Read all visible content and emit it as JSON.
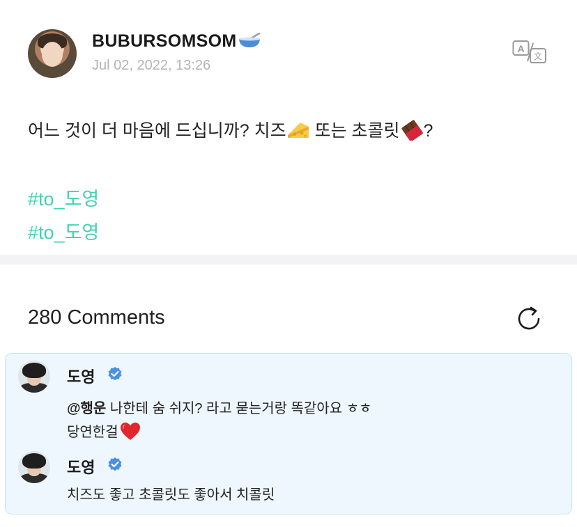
{
  "post": {
    "author": "BUBURSOMSOM",
    "author_emoji": "bowl-spoon-icon",
    "date": "Jul 02, 2022, 13:26",
    "text_part1": "어느 것이 더 마음에 드십니까? 치즈",
    "text_part2": " 또는 초콜릿",
    "text_part3": "?",
    "hashtags": [
      "#to_도영",
      "#to_도영"
    ]
  },
  "comments_section": {
    "count_label": "280 Comments"
  },
  "thread": {
    "comments": [
      {
        "author": "도영",
        "mention": "@행운",
        "line1": " 나한테 숨 쉬지? 라고 묻는거랑 똑같아요 ㅎㅎ",
        "line2": "당연한걸"
      },
      {
        "author": "도영",
        "line1": "치즈도 좋고 초콜릿도 좋아서 치콜릿"
      }
    ]
  },
  "colors": {
    "hashtag": "#3fd3b5",
    "thread_bg": "#eef7fd",
    "thread_border": "#c9e3f3",
    "verified": "#4a90e2",
    "date": "#b4b4b4"
  }
}
